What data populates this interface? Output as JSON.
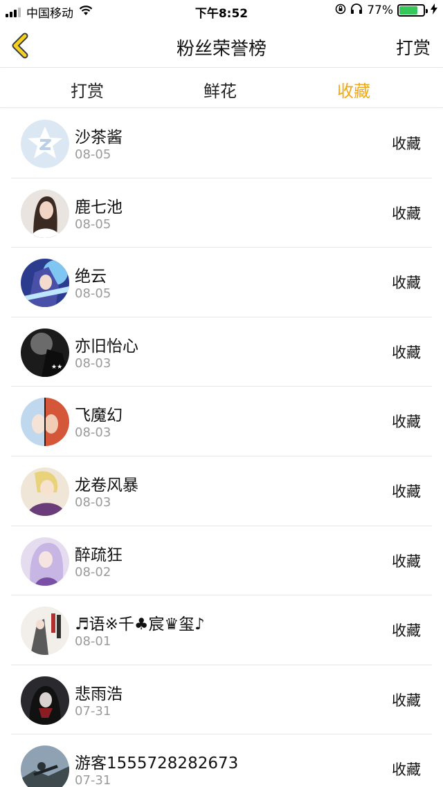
{
  "status_bar": {
    "carrier": "中国移动",
    "time": "下午8:52",
    "battery_percent": "77%",
    "battery_level": 0.77,
    "icons": [
      "signal-icon",
      "wifi-icon",
      "orientation-lock-icon",
      "headphones-icon",
      "battery-icon",
      "charging-icon"
    ]
  },
  "nav": {
    "back_icon": "chevron-left-icon",
    "title": "粉丝荣誉榜",
    "right_label": "打赏"
  },
  "tabs": [
    {
      "label": "打赏",
      "active": false
    },
    {
      "label": "鲜花",
      "active": false
    },
    {
      "label": "收藏",
      "active": true
    }
  ],
  "colors": {
    "accent": "#f0a81a",
    "back_chevron_fill": "#f4d21f",
    "date_gray": "#9a9a9a"
  },
  "list": [
    {
      "name": "沙茶酱",
      "date": "08-05",
      "action": "收藏"
    },
    {
      "name": "鹿七池",
      "date": "08-05",
      "action": "收藏"
    },
    {
      "name": "绝云",
      "date": "08-05",
      "action": "收藏"
    },
    {
      "name": "亦旧怡心",
      "date": "08-03",
      "action": "收藏"
    },
    {
      "name": "飞魔幻",
      "date": "08-03",
      "action": "收藏"
    },
    {
      "name": "龙卷风暴",
      "date": "08-03",
      "action": "收藏"
    },
    {
      "name": "醉疏狂",
      "date": "08-02",
      "action": "收藏"
    },
    {
      "name": "♬语※千♣宸♛玺♪",
      "date": "08-01",
      "action": "收藏"
    },
    {
      "name": "悲雨浩",
      "date": "07-31",
      "action": "收藏"
    },
    {
      "name": "游客1555728282673",
      "date": "07-31",
      "action": "收藏"
    }
  ]
}
